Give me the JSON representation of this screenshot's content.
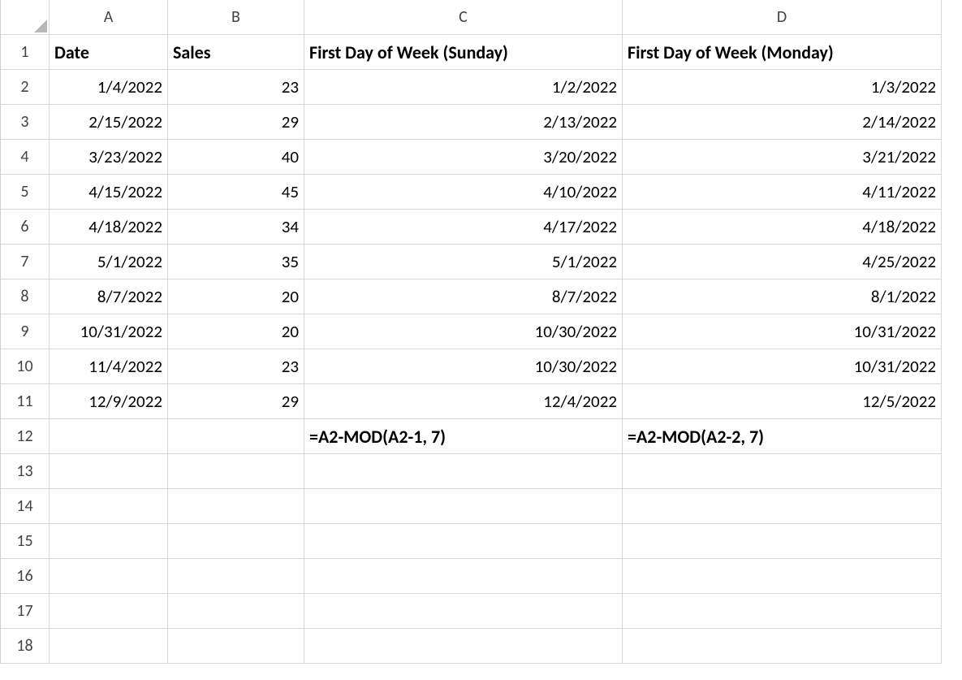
{
  "columns": [
    "A",
    "B",
    "C",
    "D"
  ],
  "rowCount": 18,
  "rowHeaderWidth": 60,
  "colWidths": {
    "A": 146,
    "B": 168,
    "C": 392,
    "D": 393
  },
  "headers": {
    "A": "Date",
    "B": "Sales",
    "C": "First Day of Week (Sunday)",
    "D": "First Day of Week (Monday)"
  },
  "rows": [
    {
      "A": "1/4/2022",
      "B": "23",
      "C": "1/2/2022",
      "D": "1/3/2022"
    },
    {
      "A": "2/15/2022",
      "B": "29",
      "C": "2/13/2022",
      "D": "2/14/2022"
    },
    {
      "A": "3/23/2022",
      "B": "40",
      "C": "3/20/2022",
      "D": "3/21/2022"
    },
    {
      "A": "4/15/2022",
      "B": "45",
      "C": "4/10/2022",
      "D": "4/11/2022"
    },
    {
      "A": "4/18/2022",
      "B": "34",
      "C": "4/17/2022",
      "D": "4/18/2022"
    },
    {
      "A": "5/1/2022",
      "B": "35",
      "C": "5/1/2022",
      "D": "4/25/2022"
    },
    {
      "A": "8/7/2022",
      "B": "20",
      "C": "8/7/2022",
      "D": "8/1/2022"
    },
    {
      "A": "10/31/2022",
      "B": "20",
      "C": "10/30/2022",
      "D": "10/31/2022"
    },
    {
      "A": "11/4/2022",
      "B": "23",
      "C": "10/30/2022",
      "D": "10/31/2022"
    },
    {
      "A": "12/9/2022",
      "B": "29",
      "C": "12/4/2022",
      "D": "12/5/2022"
    }
  ],
  "formulas": {
    "C": "=A2-MOD(A2-1, 7)",
    "D": "=A2-MOD(A2-2, 7)"
  }
}
